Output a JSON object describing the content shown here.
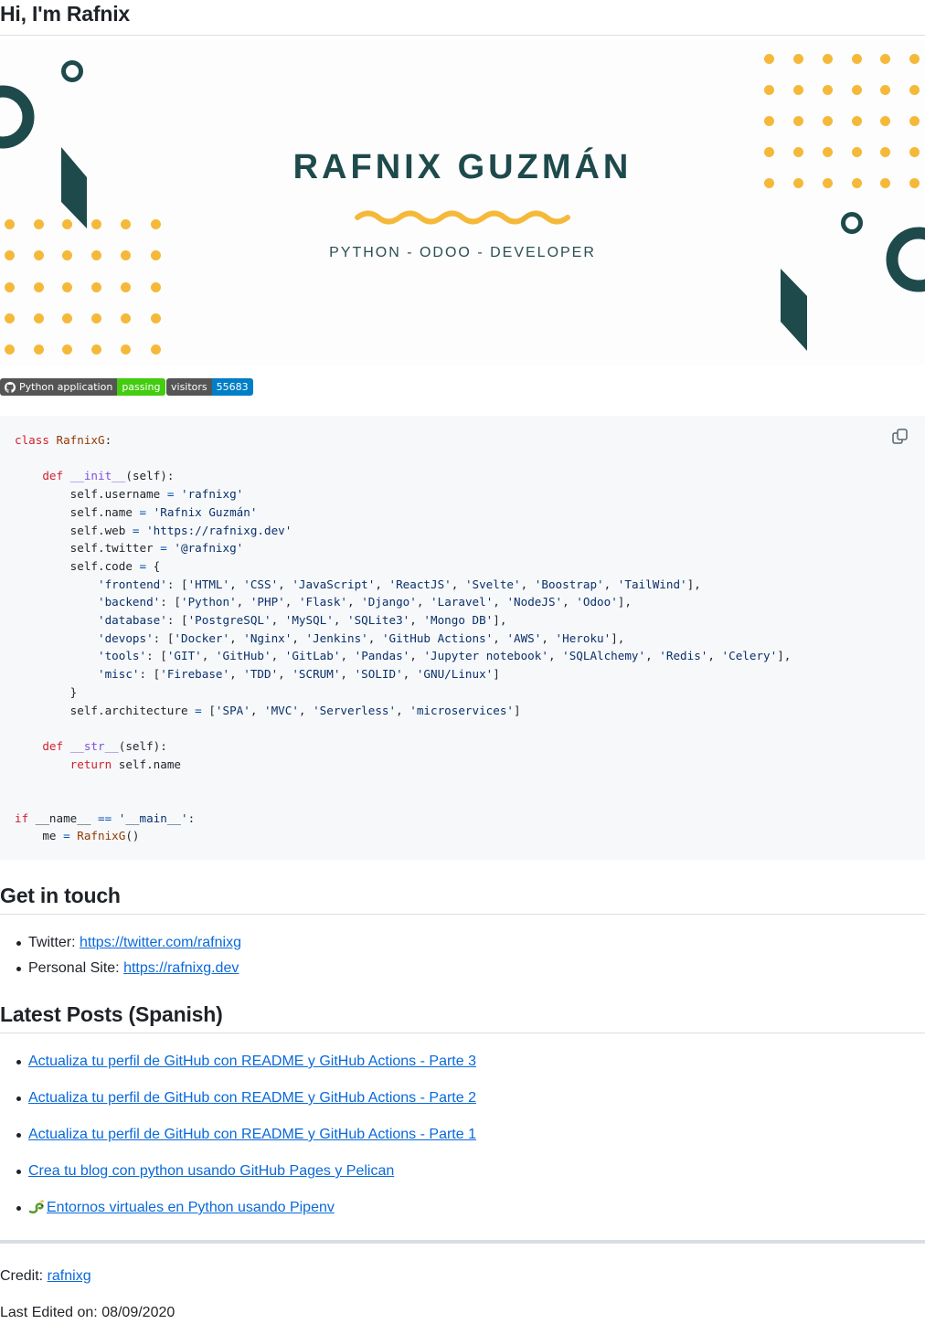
{
  "greeting": "Hi, I'm Rafnix",
  "banner": {
    "name": "RAFNIX GUZMÁN",
    "subtitle": "PYTHON - ODOO - DEVELOPER",
    "accent_color": "#f5b93a",
    "shape_color": "#1e4a4c"
  },
  "badges": {
    "workflow": {
      "icon": "github-icon",
      "label": "Python application",
      "status": "passing"
    },
    "visitors": {
      "label": "visitors",
      "count": "55683"
    }
  },
  "code": {
    "language": "python",
    "lines": [
      "class RafnixG:",
      "",
      "    def __init__(self):",
      "        self.username = 'rafnixg'",
      "        self.name = 'Rafnix Guzmán'",
      "        self.web = 'https://rafnixg.dev'",
      "        self.twitter = '@rafnixg'",
      "        self.code = {",
      "            'frontend': ['HTML', 'CSS', 'JavaScript', 'ReactJS', 'Svelte', 'Boostrap', 'TailWind'],",
      "            'backend': ['Python', 'PHP', 'Flask', 'Django', 'Laravel', 'NodeJS', 'Odoo'],",
      "            'database': ['PostgreSQL', 'MySQL', 'SQLite3', 'Mongo DB'],",
      "            'devops': ['Docker', 'Nginx', 'Jenkins', 'GitHub Actions', 'AWS', 'Heroku'],",
      "            'tools': ['GIT', 'GitHub', 'GitLab', 'Pandas', 'Jupyter notebook', 'SQLAlchemy', 'Redis', 'Celery'],",
      "            'misc': ['Firebase', 'TDD', 'SCRUM', 'SOLID', 'GNU/Linux']",
      "        }",
      "        self.architecture = ['SPA', 'MVC', 'Serverless', 'microservices']",
      "",
      "    def __str__(self):",
      "        return self.name",
      "",
      "",
      "if __name__ == '__main__':",
      "    me = RafnixG()"
    ]
  },
  "contact": {
    "heading": "Get in touch",
    "items": [
      {
        "label": "Twitter: ",
        "link": "https://twitter.com/rafnixg"
      },
      {
        "label": "Personal Site: ",
        "link": "https://rafnixg.dev"
      }
    ]
  },
  "posts": {
    "heading": "Latest Posts (Spanish)",
    "items": [
      "Actualiza tu perfil de GitHub con README y GitHub Actions - Parte 3",
      "Actualiza tu perfil de GitHub con README y GitHub Actions - Parte 2",
      "Actualiza tu perfil de GitHub con README y GitHub Actions - Parte 1",
      "Crea tu blog con python usando GitHub Pages y Pelican",
      "Entornos virtuales en Python usando Pipenv"
    ],
    "last_item_icon": "snake-icon"
  },
  "footer": {
    "credit_label": "Credit: ",
    "credit_link": "rafnixg",
    "last_edited": "Last Edited on: 08/09/2020"
  }
}
